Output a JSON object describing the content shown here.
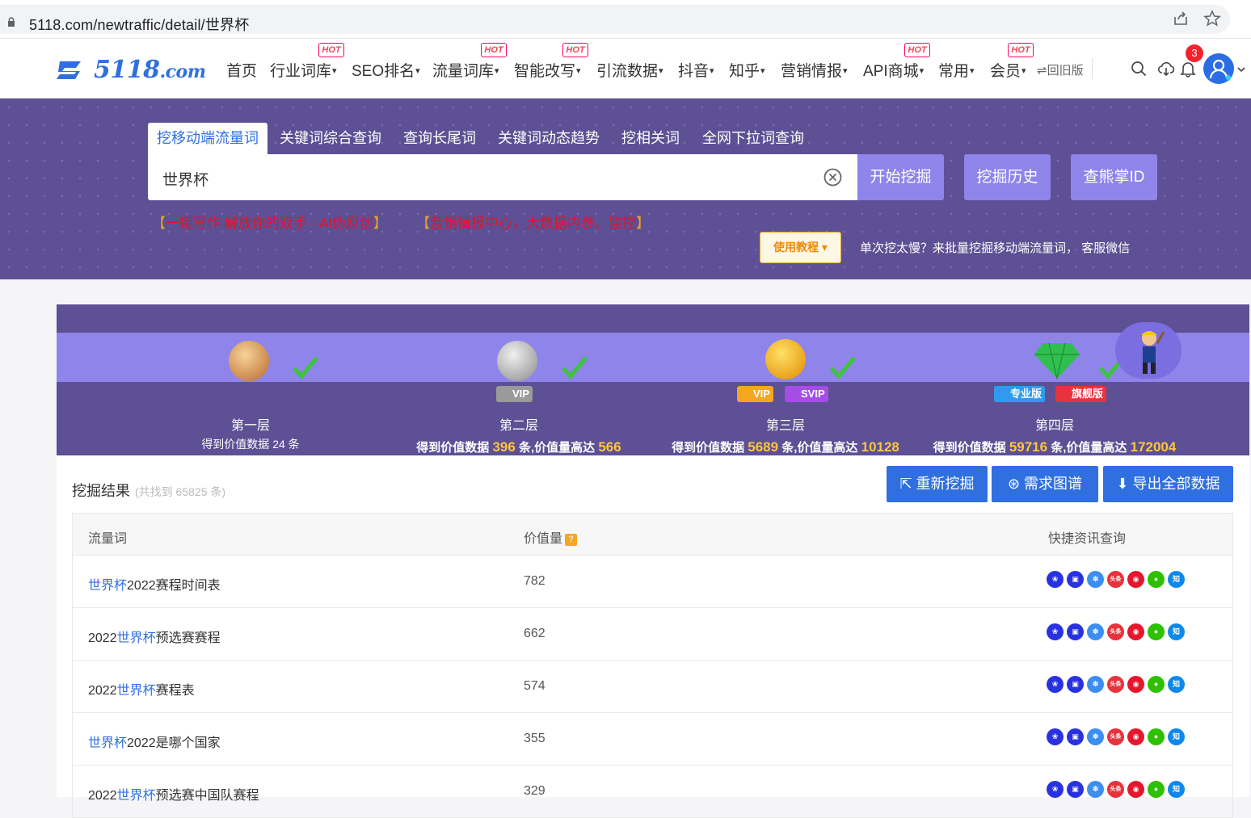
{
  "browser": {
    "url": "5118.com/newtraffic/detail/世界杯"
  },
  "nav": {
    "logo_main": "5118",
    "logo_suffix": ".com",
    "items": [
      {
        "label": "首页",
        "caret": ""
      },
      {
        "label": "行业词库",
        "caret": "▾"
      },
      {
        "label": "SEO排名",
        "caret": "▾"
      },
      {
        "label": "流量词库",
        "caret": "▾"
      },
      {
        "label": "智能改写",
        "caret": "▾"
      },
      {
        "label": "引流数据",
        "caret": "▾"
      },
      {
        "label": "抖音",
        "caret": "▾"
      },
      {
        "label": "知乎",
        "caret": "▾"
      },
      {
        "label": "营销情报",
        "caret": "▾"
      },
      {
        "label": "API商城",
        "caret": "▾"
      },
      {
        "label": "常用",
        "caret": "▾"
      },
      {
        "label": "会员",
        "caret": "▾"
      }
    ],
    "hot_label": "HOT",
    "old_version": "⇌回旧版",
    "notification_count": "3"
  },
  "hero": {
    "tabs": [
      "挖移动端流量词",
      "关键词综合查询",
      "查询长尾词",
      "关键词动态趋势",
      "挖相关词",
      "全网下拉词查询"
    ],
    "search_value": "世界杯",
    "buttons": {
      "start": "开始挖掘",
      "history": "挖掘历史",
      "id": "查熊掌ID"
    },
    "promo1": {
      "open": "【",
      "text": "一键写作 解放你的双手 - AI伪原创",
      "close": "】"
    },
    "promo2": {
      "open": "【",
      "text": "营销情报中心，大数据内参、监控",
      "close": "】"
    },
    "tutorial": "使用教程 ▾",
    "hint": "单次挖太慢？来批量挖掘移动端流量词， 客服微信"
  },
  "levels": [
    {
      "title": "第一层",
      "desc_prefix": "得到价值数据 24 条",
      "count": "",
      "mid": "",
      "value": ""
    },
    {
      "title": "第二层",
      "desc_prefix": "得到价值数据 ",
      "count": "396",
      "mid": " 条,价值量高达 ",
      "value": "566"
    },
    {
      "title": "第三层",
      "desc_prefix": "得到价值数据 ",
      "count": "5689",
      "mid": " 条,价值量高达 ",
      "value": "10128"
    },
    {
      "title": "第四层",
      "desc_prefix": "得到价值数据 ",
      "count": "59716",
      "mid": " 条,价值量高达 ",
      "value": "172004"
    }
  ],
  "tiers": {
    "vip": "VIP",
    "svip": "SVIP",
    "pro": "专业版",
    "flagship": "旗舰版"
  },
  "results": {
    "title": "挖掘结果",
    "count": "(共找到 65825 条)",
    "buttons": {
      "redo": "⇱ 重新挖掘",
      "graph": "⊛ 需求图谱",
      "export": "⬇ 导出全部数据"
    },
    "columns": {
      "keyword": "流量词",
      "value": "价值量",
      "help": "?",
      "quick": "快捷资讯查询"
    },
    "rows": [
      {
        "pre": "",
        "hl": "世界杯",
        "post": "2022赛程时间表",
        "value": "782"
      },
      {
        "pre": "2022",
        "hl": "世界杯",
        "post": "预选赛赛程",
        "value": "662"
      },
      {
        "pre": "2022",
        "hl": "世界杯",
        "post": "赛程表",
        "value": "574"
      },
      {
        "pre": "",
        "hl": "世界杯",
        "post": "2022是哪个国家",
        "value": "355"
      },
      {
        "pre": "2022",
        "hl": "世界杯",
        "post": "预选赛中国队赛程",
        "value": "329"
      }
    ],
    "quick_icons": [
      {
        "name": "baidu-icon",
        "glyph": "❀",
        "color": "#2932e1"
      },
      {
        "name": "mobile-icon",
        "glyph": "▣",
        "color": "#2932e1"
      },
      {
        "name": "paw-icon",
        "glyph": "✽",
        "color": "#3d8ef0"
      },
      {
        "name": "toutiao-icon",
        "glyph": "头条",
        "color": "#e8323c"
      },
      {
        "name": "weibo-icon",
        "glyph": "◉",
        "color": "#e6162d"
      },
      {
        "name": "wechat-icon",
        "glyph": "●",
        "color": "#2dc100"
      },
      {
        "name": "zhihu-icon",
        "glyph": "知",
        "color": "#0f88eb"
      }
    ]
  },
  "colors": {
    "primary": "#2f6fe0",
    "hero_bg": "#5d5094",
    "hero_btn": "#8f84ea",
    "hot": "#f0475b",
    "gold": "#ffc53d"
  }
}
